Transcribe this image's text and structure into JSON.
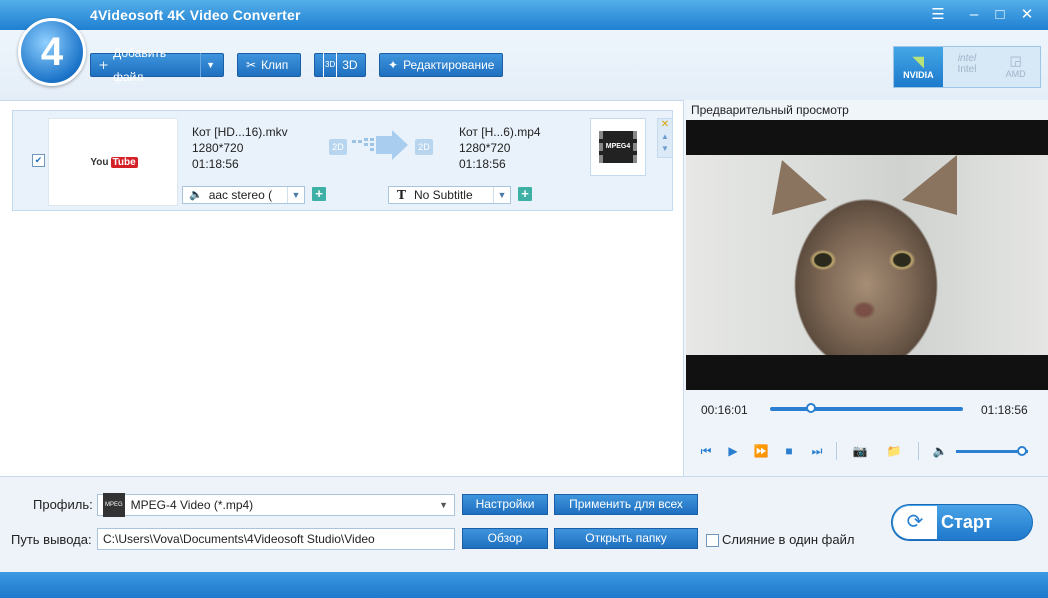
{
  "app": {
    "title": "4Videosoft 4K Video Converter",
    "logo_text": "4"
  },
  "window_controls": {
    "menu": "☰",
    "minimize": "–",
    "maximize": "□",
    "close": "✕"
  },
  "toolbar": {
    "add_file": "Добавить файл",
    "clip": "Клип",
    "three_d": "3D",
    "edit": "Редактирование"
  },
  "gpu": {
    "nvidia": "NVIDIA",
    "intel": "Intel",
    "amd": "AMD"
  },
  "file": {
    "thumb_logo_left": "You",
    "thumb_logo_right": "Tube",
    "source": {
      "name": "Кот [HD...16).mkv",
      "resolution": "1280*720",
      "duration": "01:18:56",
      "badge": "2D"
    },
    "target": {
      "name": "Кот [H...6).mp4",
      "resolution": "1280*720",
      "duration": "01:18:56",
      "badge": "2D"
    },
    "format_icon": "MPEG4",
    "audio": "aac stereo (",
    "subtitle": "No Subtitle"
  },
  "preview": {
    "label": "Предварительный просмотр",
    "current_time": "00:16:01",
    "total_time": "01:18:56",
    "progress": 0.21,
    "volume": 0.92
  },
  "bottom": {
    "profile_label": "Профиль:",
    "profile_value": "MPEG-4 Video (*.mp4)",
    "settings_btn": "Настройки",
    "apply_all_btn": "Применить для всех",
    "output_label": "Путь вывода:",
    "output_value": "C:\\Users\\Vova\\Documents\\4Videosoft Studio\\Video",
    "browse_btn": "Обзор",
    "open_folder_btn": "Открыть папку",
    "merge_label": "Слияние в один файл",
    "start_btn": "Старт"
  }
}
